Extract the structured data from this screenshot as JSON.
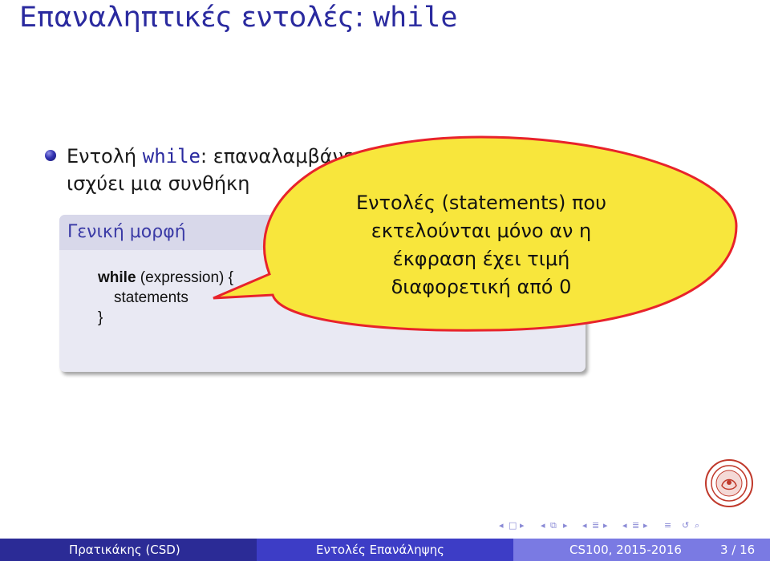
{
  "slide": {
    "title_prefix": "Επαναληπτικές εντολές: ",
    "title_keyword": "while"
  },
  "bullet": {
    "prefix": "Εντολή ",
    "keyword": "while",
    "line1_rest": ": επαναλαμβάνει κάποιες εντολές για όσο",
    "line2": "ισχύει μια συνθήκη"
  },
  "block": {
    "title": "Γενική μορφή",
    "code_keyword": "while",
    "code_line1_rest": " (expression) {",
    "code_line2": "statements",
    "code_line3": "}"
  },
  "callout": {
    "lines": [
      "Εντολές (statements) που",
      "εκτελούνται μόνο αν η",
      "έκφραση έχει τιμή",
      "διαφορετική από 0"
    ],
    "fill_color": "#f8e63c",
    "stroke_color": "#e8232b"
  },
  "navigation": {
    "icons": [
      "nav-frame-left",
      "nav-frame-right",
      "nav-subsection-left",
      "nav-subsection-right",
      "nav-section-left",
      "nav-section-right",
      "nav-align",
      "nav-search"
    ]
  },
  "footer": {
    "author": "Πρατικάκης (CSD)",
    "topic": "Εντολές Επανάληψης",
    "course": "CS100, 2015-2016",
    "page": "3 / 16",
    "colors": [
      "#2b2b96",
      "#3d3dc6",
      "#7a7ae3"
    ]
  }
}
